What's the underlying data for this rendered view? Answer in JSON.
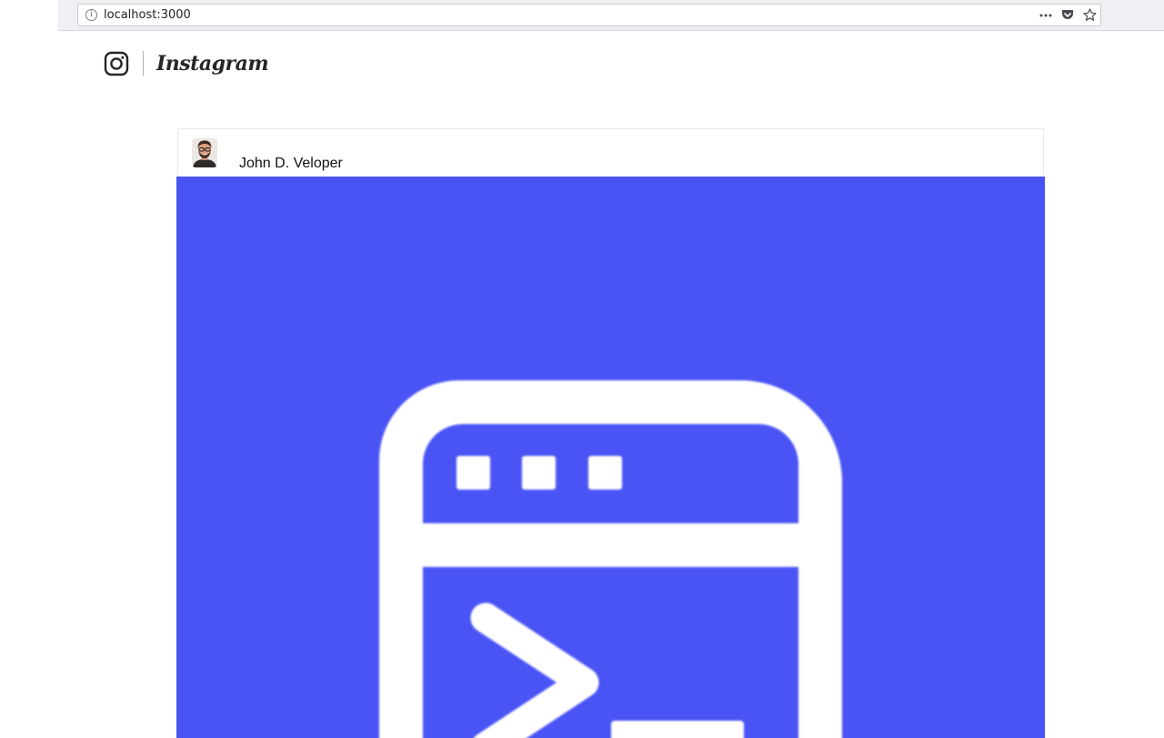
{
  "browser": {
    "url": "localhost:3000",
    "info_glyph": "i",
    "icons": [
      "info-icon",
      "more-dots-icon",
      "pocket-icon",
      "bookmark-star-icon"
    ]
  },
  "header": {
    "logo_icon": "instagram-camera-icon",
    "wordmark": "Instagram"
  },
  "post": {
    "username": "John D. Veloper",
    "avatar_icon": "user-avatar",
    "image_icon": "terminal-window-icon",
    "image_background": "#4a54f5",
    "image_foreground": "#ffffff"
  },
  "colors": {
    "browser_chrome": "#f0f0f4",
    "text": "#262626",
    "post_bg": "#4a54f5"
  }
}
